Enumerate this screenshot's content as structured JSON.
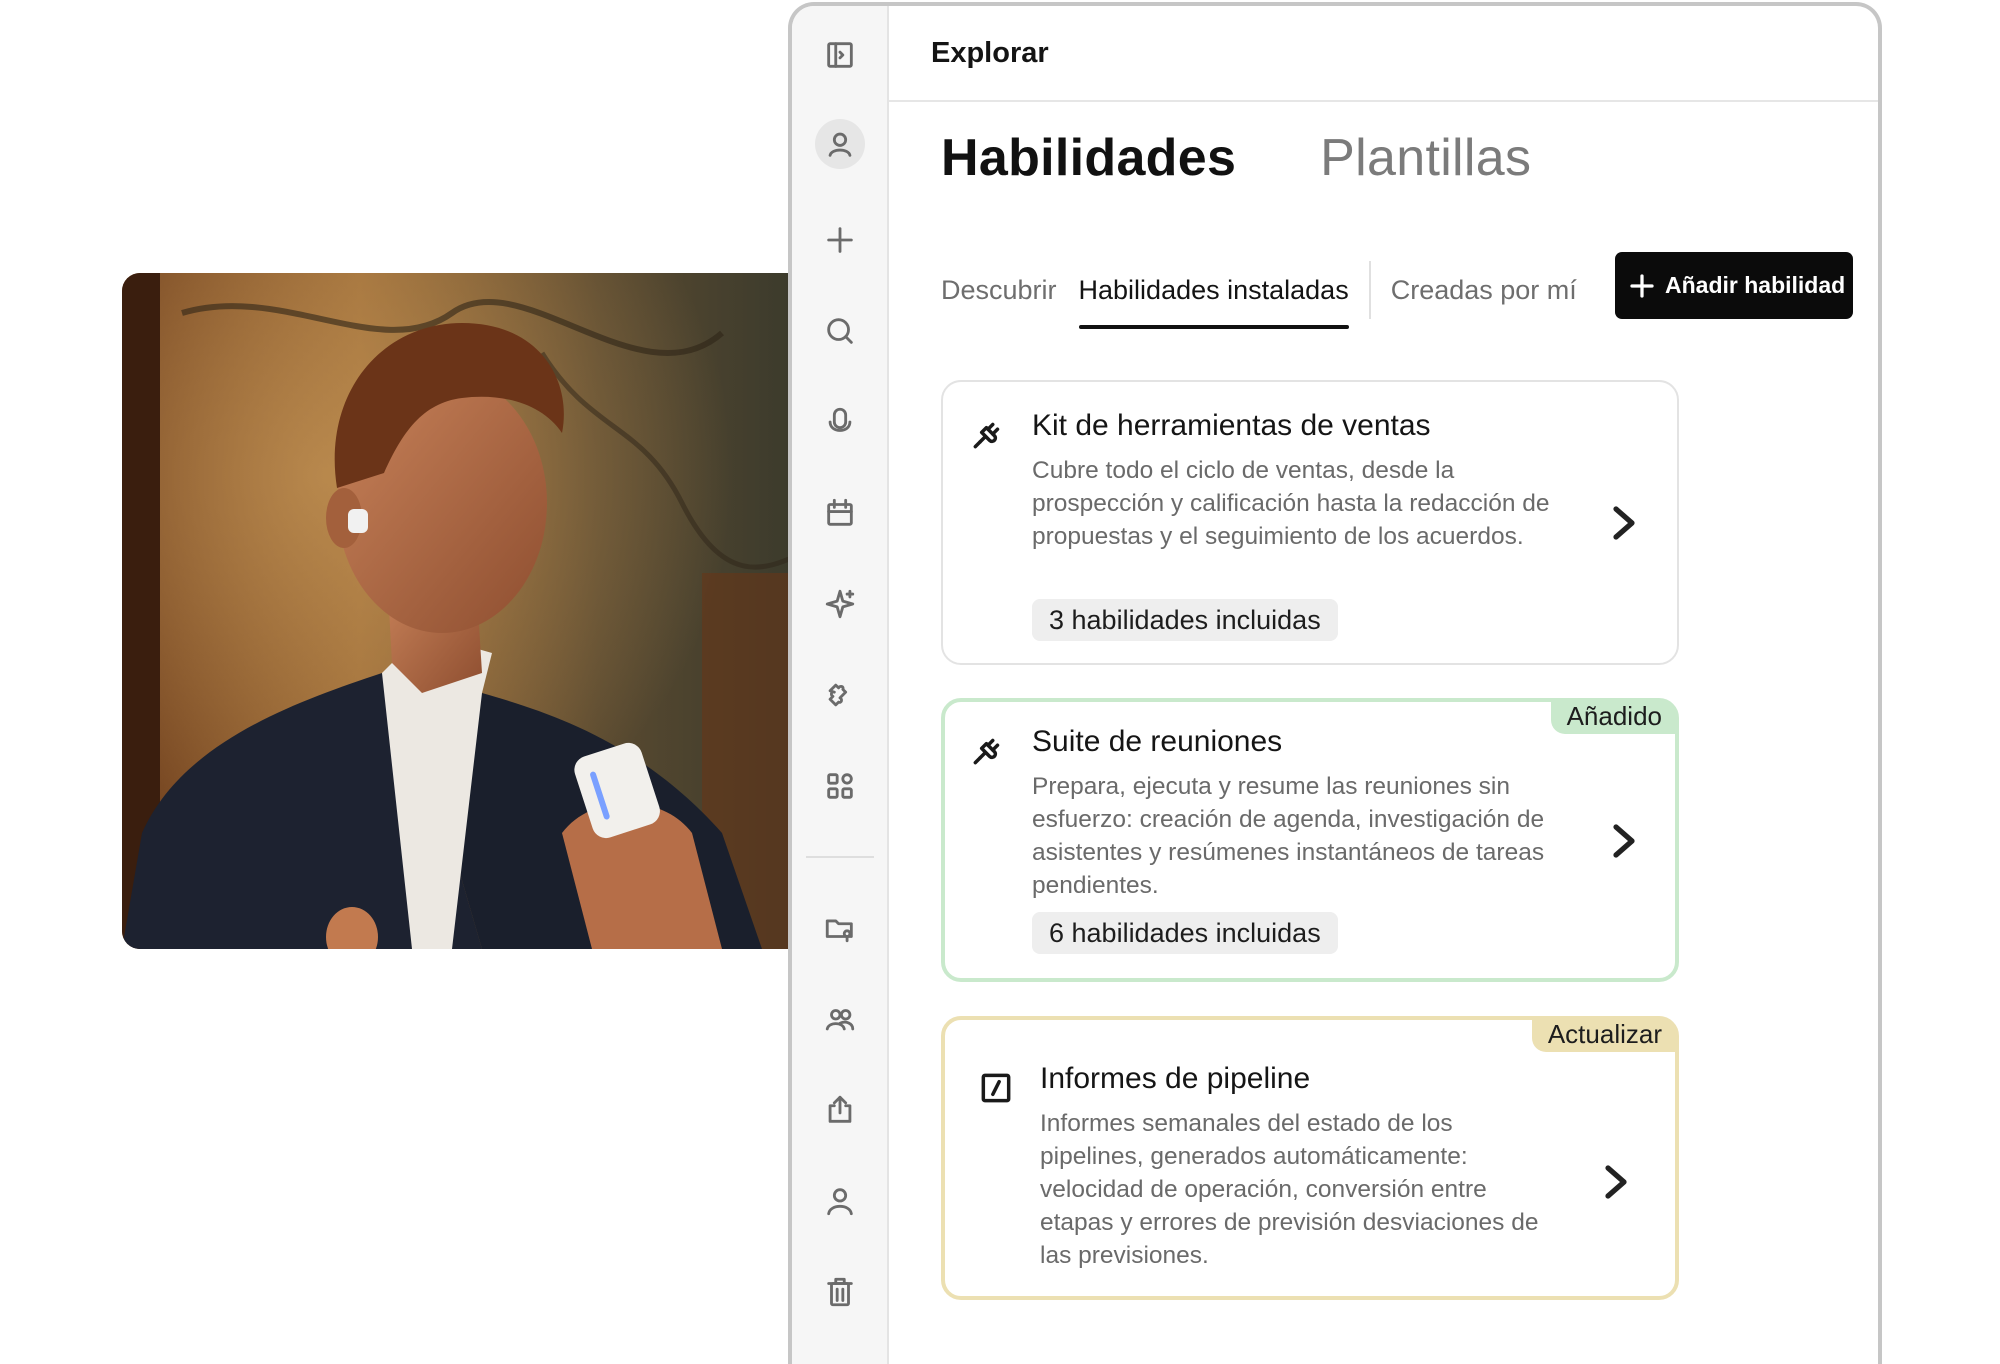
{
  "window": {
    "title": "Explorar"
  },
  "tabs": {
    "primary": [
      {
        "label": "Habilidades",
        "active": true
      },
      {
        "label": "Plantillas",
        "active": false
      }
    ],
    "secondary": [
      {
        "label": "Descubrir",
        "active": false
      },
      {
        "label": "Habilidades instaladas",
        "active": true
      },
      {
        "label": "Creadas por mí",
        "active": false
      }
    ]
  },
  "toolbar": {
    "add_label": "Añadir habilidad",
    "add_icon": "plus-icon"
  },
  "sidebar": {
    "icons": [
      "sidebar-toggle-icon",
      "profile-icon",
      "plus-icon",
      "search-icon",
      "microphone-icon",
      "calendar-icon",
      "sparkle-icon",
      "puzzle-icon",
      "apps-grid-icon",
      "shared-folder-icon",
      "team-icon",
      "share-icon",
      "user-icon",
      "trash-icon"
    ]
  },
  "cards": [
    {
      "title": "Kit de herramientas de ventas",
      "description": "Cubre todo el ciclo de ventas, desde la prospección y calificación hasta la redacción de propuestas y el seguimiento de los acuerdos.",
      "pill": "3 habilidades incluidas",
      "badge": "",
      "icon": "plug-icon"
    },
    {
      "title": "Suite de reuniones",
      "description": "Prepara, ejecuta y resume las reuniones sin esfuerzo: creación de agenda, investigación de asistentes y resúmenes instantáneos de tareas pendientes.",
      "pill": "6 habilidades incluidas",
      "badge": "Añadido",
      "icon": "plug-icon"
    },
    {
      "title": "Informes de pipeline",
      "description": "Informes semanales del estado de los pipelines, generados automáticamente: velocidad de operación, conversión entre etapas y errores de previsión desviaciones de las previsiones.",
      "pill": "",
      "badge": "Actualizar",
      "icon": "slash-command-icon"
    }
  ],
  "colors": {
    "accent": "#0b0b0b",
    "added_border": "#c9e9cc",
    "update_border": "#ece0b2",
    "pill_background": "#eeeeee"
  }
}
